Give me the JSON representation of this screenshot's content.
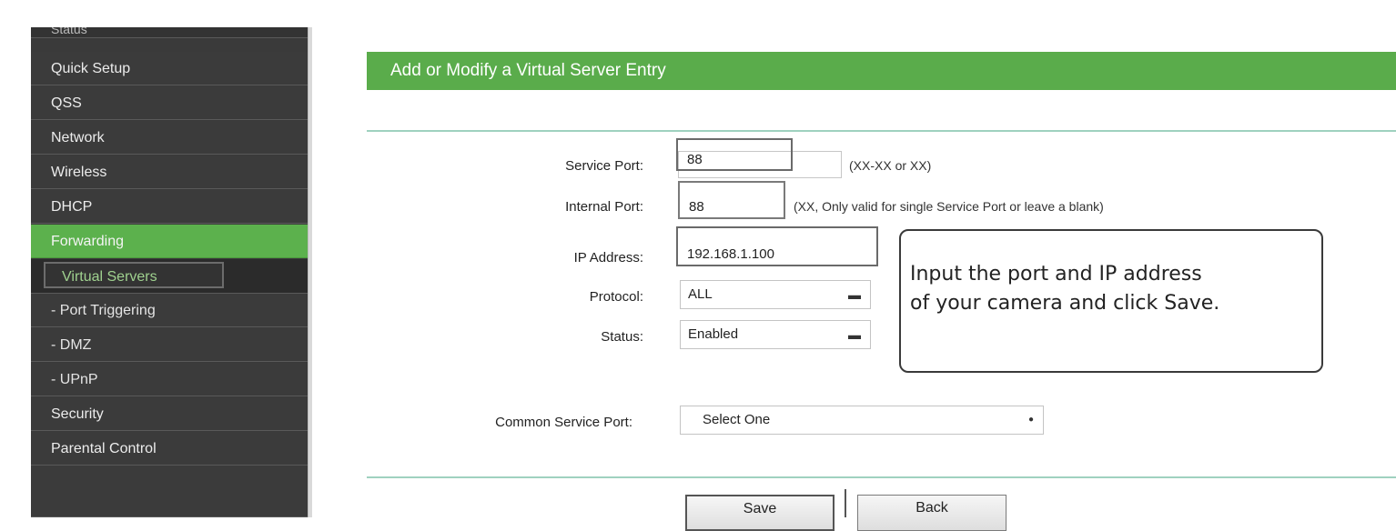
{
  "sidebar": {
    "items": [
      {
        "label": "Status"
      },
      {
        "label": "Quick Setup"
      },
      {
        "label": "QSS"
      },
      {
        "label": "Network"
      },
      {
        "label": "Wireless"
      },
      {
        "label": "DHCP"
      },
      {
        "label": "Forwarding"
      },
      {
        "label": "Virtual Servers"
      },
      {
        "label": "- Port Triggering"
      },
      {
        "label": "- DMZ"
      },
      {
        "label": "- UPnP"
      },
      {
        "label": "Security"
      },
      {
        "label": "Parental Control"
      }
    ]
  },
  "main": {
    "title": "Add or Modify a Virtual Server Entry",
    "form": {
      "service_port": {
        "label": "Service Port:",
        "value": "88",
        "hint": "(XX-XX or XX)"
      },
      "internal_port": {
        "label": "Internal Port:",
        "value": "88",
        "hint": "(XX, Only valid for single Service Port or leave a blank)"
      },
      "ip_address": {
        "label": "IP Address:",
        "value": "192.168.1.100"
      },
      "protocol": {
        "label": "Protocol:",
        "value": "ALL"
      },
      "status": {
        "label": "Status:",
        "value": "Enabled"
      },
      "common_service_port": {
        "label": "Common Service Port:",
        "value": "Select One"
      }
    },
    "buttons": {
      "save": "Save",
      "back": "Back"
    }
  },
  "callout": {
    "line1": "Input the port and IP address",
    "line2": "of your camera and click Save."
  },
  "colors": {
    "accent": "#5aac4b",
    "sidebar_bg": "#3a3a3a"
  }
}
